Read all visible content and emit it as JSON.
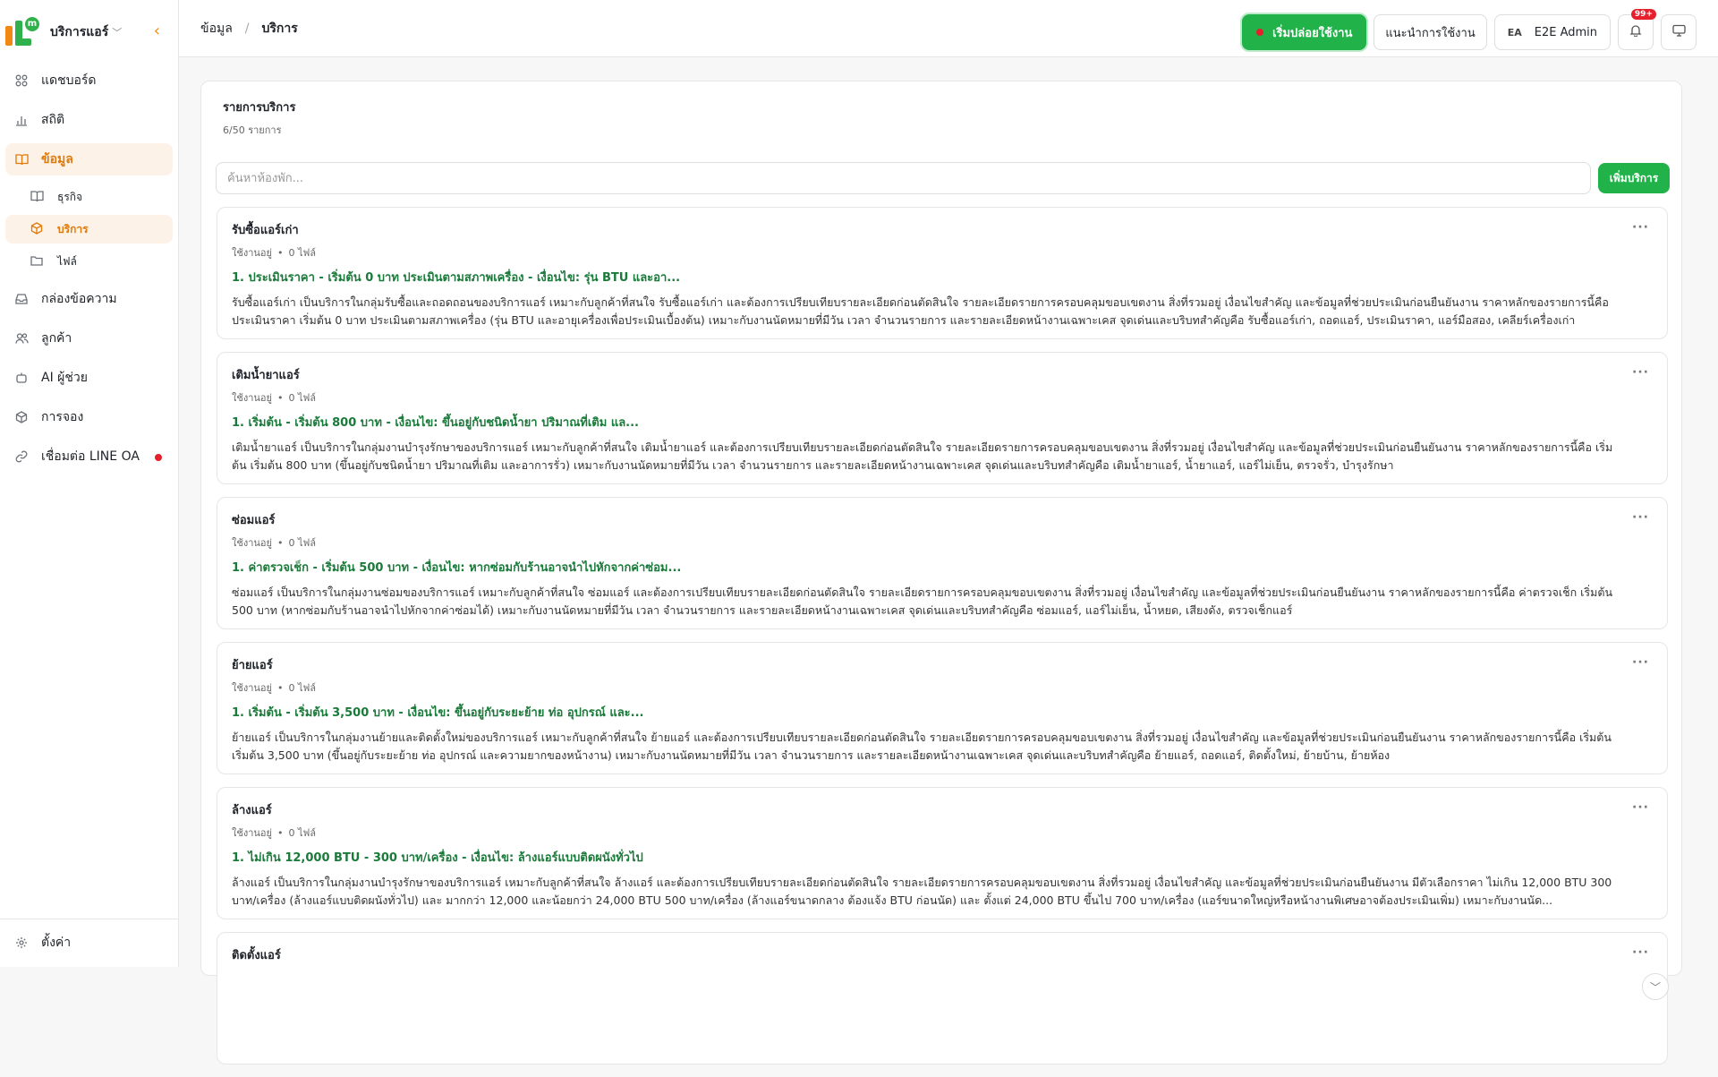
{
  "sidebar": {
    "brand": {
      "logo_letter": "m",
      "name": "บริการแอร์"
    },
    "items": [
      {
        "label": "แดชบอร์ด"
      },
      {
        "label": "สถิติ"
      },
      {
        "label": "ข้อมูล"
      },
      {
        "label": "กล่องข้อความ"
      },
      {
        "label": "ลูกค้า"
      },
      {
        "label": "AI ผู้ช่วย"
      },
      {
        "label": "การจอง"
      },
      {
        "label": "เชื่อมต่อ LINE OA"
      }
    ],
    "sub_items": [
      {
        "label": "ธุรกิจ"
      },
      {
        "label": "บริการ"
      },
      {
        "label": "ไฟล์"
      }
    ],
    "settings": {
      "label": "ตั้งค่า"
    }
  },
  "header": {
    "breadcrumb": {
      "parent": "ข้อมูล",
      "current": "บริการ"
    },
    "launch_label": "เริ่มปล่อยใช้งาน",
    "guide_label": "แนะนำการใช้งาน",
    "user": {
      "initials": "EA",
      "name": "E2E Admin"
    },
    "notification_badge": "99+"
  },
  "panel": {
    "title": "รายการบริการ",
    "count": "6/50 รายการ",
    "search_placeholder": "ค้นหาห้องพัก...",
    "add_label": "เพิ่มบริการ"
  },
  "services": [
    {
      "name": "รับซื้อแอร์เก่า",
      "status": "ใช้งานอยู่",
      "files": "0 ไฟล์",
      "price": "1. ประเมินราคา - เริ่มต้น 0 บาท ประเมินตามสภาพเครื่อง - เงื่อนไข: รุ่น BTU และอา...",
      "description": "รับซื้อแอร์เก่า เป็นบริการในกลุ่มรับซื้อและถอดถอนของบริการแอร์ เหมาะกับลูกค้าที่สนใจ รับซื้อแอร์เก่า และต้องการเปรียบเทียบรายละเอียดก่อนตัดสินใจ รายละเอียดรายการครอบคลุมขอบเขตงาน สิ่งที่รวมอยู่ เงื่อนไขสำคัญ และข้อมูลที่ช่วยประเมินก่อนยืนยันงาน ราคาหลักของรายการนี้คือ ประเมินราคา เริ่มต้น 0 บาท ประเมินตามสภาพเครื่อง (รุ่น BTU และอายุเครื่องเพื่อประเมินเบื้องต้น) เหมาะกับงานนัดหมายที่มีวัน เวลา จำนวนรายการ และรายละเอียดหน้างานเฉพาะเคส จุดเด่นและบริบทสำคัญคือ รับซื้อแอร์เก่า, ถอดแอร์, ประเมินราคา, แอร์มือสอง, เคลียร์เครื่องเก่า"
    },
    {
      "name": "เติมน้ำยาแอร์",
      "status": "ใช้งานอยู่",
      "files": "0 ไฟล์",
      "price": "1. เริ่มต้น - เริ่มต้น 800 บาท - เงื่อนไข: ขึ้นอยู่กับชนิดน้ำยา ปริมาณที่เติม แล...",
      "description": "เติมน้ำยาแอร์ เป็นบริการในกลุ่มงานบำรุงรักษาของบริการแอร์ เหมาะกับลูกค้าที่สนใจ เติมน้ำยาแอร์ และต้องการเปรียบเทียบรายละเอียดก่อนตัดสินใจ รายละเอียดรายการครอบคลุมขอบเขตงาน สิ่งที่รวมอยู่ เงื่อนไขสำคัญ และข้อมูลที่ช่วยประเมินก่อนยืนยันงาน ราคาหลักของรายการนี้คือ เริ่มต้น เริ่มต้น 800 บาท (ขึ้นอยู่กับชนิดน้ำยา ปริมาณที่เติม และอาการรั่ว) เหมาะกับงานนัดหมายที่มีวัน เวลา จำนวนรายการ และรายละเอียดหน้างานเฉพาะเคส จุดเด่นและบริบทสำคัญคือ เติมน้ำยาแอร์, น้ำยาแอร์, แอร์ไม่เย็น, ตรวจรั่ว, บำรุงรักษา"
    },
    {
      "name": "ซ่อมแอร์",
      "status": "ใช้งานอยู่",
      "files": "0 ไฟล์",
      "price": "1. ค่าตรวจเช็ก - เริ่มต้น 500 บาท - เงื่อนไข: หากซ่อมกับร้านอาจนำไปหักจากค่าซ่อม...",
      "description": "ซ่อมแอร์ เป็นบริการในกลุ่มงานซ่อมของบริการแอร์ เหมาะกับลูกค้าที่สนใจ ซ่อมแอร์ และต้องการเปรียบเทียบรายละเอียดก่อนตัดสินใจ รายละเอียดรายการครอบคลุมขอบเขตงาน สิ่งที่รวมอยู่ เงื่อนไขสำคัญ และข้อมูลที่ช่วยประเมินก่อนยืนยันงาน ราคาหลักของรายการนี้คือ ค่าตรวจเช็ก เริ่มต้น 500 บาท (หากซ่อมกับร้านอาจนำไปหักจากค่าซ่อมได้) เหมาะกับงานนัดหมายที่มีวัน เวลา จำนวนรายการ และรายละเอียดหน้างานเฉพาะเคส จุดเด่นและบริบทสำคัญคือ ซ่อมแอร์, แอร์ไม่เย็น, น้ำหยด, เสียงดัง, ตรวจเช็กแอร์"
    },
    {
      "name": "ย้ายแอร์",
      "status": "ใช้งานอยู่",
      "files": "0 ไฟล์",
      "price": "1. เริ่มต้น - เริ่มต้น 3,500 บาท - เงื่อนไข: ขึ้นอยู่กับระยะย้าย ท่อ อุปกรณ์ และ...",
      "description": "ย้ายแอร์ เป็นบริการในกลุ่มงานย้ายและติดตั้งใหม่ของบริการแอร์ เหมาะกับลูกค้าที่สนใจ ย้ายแอร์ และต้องการเปรียบเทียบรายละเอียดก่อนตัดสินใจ รายละเอียดรายการครอบคลุมขอบเขตงาน สิ่งที่รวมอยู่ เงื่อนไขสำคัญ และข้อมูลที่ช่วยประเมินก่อนยืนยันงาน ราคาหลักของรายการนี้คือ เริ่มต้น เริ่มต้น 3,500 บาท (ขึ้นอยู่กับระยะย้าย ท่อ อุปกรณ์ และความยากของหน้างาน) เหมาะกับงานนัดหมายที่มีวัน เวลา จำนวนรายการ และรายละเอียดหน้างานเฉพาะเคส จุดเด่นและบริบทสำคัญคือ ย้ายแอร์, ถอดแอร์, ติดตั้งใหม่, ย้ายบ้าน, ย้ายห้อง"
    },
    {
      "name": "ล้างแอร์",
      "status": "ใช้งานอยู่",
      "files": "0 ไฟล์",
      "price": "1. ไม่เกิน 12,000 BTU - 300 บาท/เครื่อง - เงื่อนไข: ล้างแอร์แบบติดผนังทั่วไป",
      "description": "ล้างแอร์ เป็นบริการในกลุ่มงานบำรุงรักษาของบริการแอร์ เหมาะกับลูกค้าที่สนใจ ล้างแอร์ และต้องการเปรียบเทียบรายละเอียดก่อนตัดสินใจ รายละเอียดรายการครอบคลุมขอบเขตงาน สิ่งที่รวมอยู่ เงื่อนไขสำคัญ และข้อมูลที่ช่วยประเมินก่อนยืนยันงาน มีตัวเลือกราคา ไม่เกิน 12,000 BTU 300 บาท/เครื่อง (ล้างแอร์แบบติดผนังทั่วไป) และ มากกว่า 12,000 และน้อยกว่า 24,000 BTU 500 บาท/เครื่อง (ล้างแอร์ขนาดกลาง ต้องแจ้ง BTU ก่อนนัด) และ ตั้งแต่ 24,000 BTU ขึ้นไป 700 บาท/เครื่อง (แอร์ขนาดใหญ่หรือหน้างานพิเศษอาจต้องประเมินเพิ่ม) เหมาะกับงานนัด..."
    },
    {
      "name": "ติดตั้งแอร์",
      "status": "",
      "files": "",
      "price": "",
      "description": ""
    }
  ]
}
